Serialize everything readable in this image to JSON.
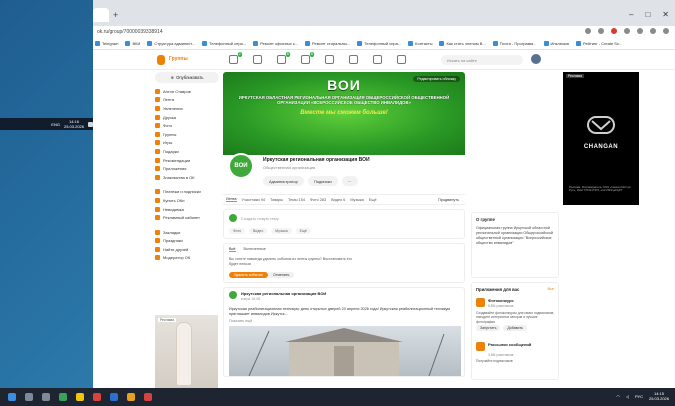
{
  "desktop": {
    "old_taskbar": {
      "lang": "ENG",
      "time": "14:16",
      "date": "25.03.2026"
    }
  },
  "browser": {
    "new_tab": "+",
    "url": "ok.ru/group/70000039338914",
    "bookmarks": [
      {
        "label": "Telegram",
        "icon": "telegram-icon"
      },
      {
        "label": "ВКИ",
        "icon": "vk-icon"
      },
      {
        "label": "Структура админист...",
        "icon": "page-icon"
      },
      {
        "label": "Телефонный спра...",
        "icon": "page-icon"
      },
      {
        "label": "Ремонт офисных к...",
        "icon": "page-icon"
      },
      {
        "label": "Ремонт стиральны...",
        "icon": "page-icon"
      },
      {
        "label": "Телефонный спра...",
        "icon": "page-icon"
      },
      {
        "label": "Контакты",
        "icon": "page-icon"
      },
      {
        "label": "Как стать членом В...",
        "icon": "page-icon"
      },
      {
        "label": "Почта - Программ...",
        "icon": "mail-icon"
      },
      {
        "label": "Инклюзия",
        "icon": "page-icon"
      },
      {
        "label": "Рейтинг - Create Sc...",
        "icon": "page-icon"
      }
    ]
  },
  "ok": {
    "logo_text": "Группы",
    "badges": [
      "2",
      "8",
      "8"
    ],
    "search_placeholder": "Искать на сайте",
    "sidebar": {
      "publish": "Опубликовать",
      "items": [
        "Антон Ставров",
        "Лента",
        "Увлечения",
        "Друзья",
        "Фото",
        "Группы",
        "Игры",
        "Подарки",
        "Рекомендации",
        "Приложения",
        "Знакомства в ОК"
      ],
      "items2": [
        "Платежи и подписки",
        "Купить ОКи",
        "Невидимка",
        "Рекламный кабинет"
      ],
      "items3": [
        "Закладки",
        "Праздники",
        "Найти друзей",
        "Модератор ОК"
      ],
      "ad_tag": "Реклама"
    },
    "cover": {
      "logo": "ВОИ",
      "org": "ИРКУТСКАЯ ОБЛАСТНАЯ РЕГИОНАЛЬНАЯ ОРГАНИЗАЦИЯ ОБЩЕРОССИЙСКОЙ ОБЩЕСТВЕННОЙ ОРГАНИЗАЦИИ «ВСЕРОССИЙСКОЕ ОБЩЕСТВО ИНВАЛИДОВ»",
      "slogan": "Вместе мы сможем больше!",
      "edit": "Редактировать обложку"
    },
    "group": {
      "logo_text": "ВОИ",
      "name": "Иркутская региональная организация ВОИ",
      "type": "Общественная организация",
      "admin_btn": "Администратор",
      "sub_btn": "Подписки",
      "more_btn": "···"
    },
    "tabs": [
      "Лента",
      "Участники 94",
      "Товары",
      "Темы 154",
      "Фото 283",
      "Видео 6",
      "Музыка",
      "Ещё"
    ],
    "promote": "Продвинуть",
    "newpost": {
      "placeholder": "Создать новую тему",
      "btns": [
        "Фото",
        "Видео",
        "Музыка",
        "Ещё"
      ]
    },
    "events": {
      "tabs": [
        "Всё",
        "Включенные"
      ],
      "question": "Вы хотите навсегда удалить события из ленты группы? Восстановить его будет нельзя",
      "delete": "Удалить событие",
      "cancel": "Отменить"
    },
    "post": {
      "name": "Иркутская региональная организация ВОИ",
      "date": "вчера 16:08",
      "text": "Иркутская реабилитационная техникум: день открытых дверей 23 апреля 2026 года! Иркутская реабилитационный техникум приглашает инвалидов Иркутск...",
      "more": "Показать ещё"
    },
    "about": {
      "title": "О группе",
      "text": "Официальная группа Иркутской областной региональной организации Общероссийской общественной организации \"Всероссийское общество инвалидов\""
    },
    "apps": {
      "title": "Приложения для вас",
      "all": "Все",
      "items": [
        {
          "name": "Фотоконкурс",
          "sub": "6,8M участников",
          "desc": "Создавайте фотоконкурсы для своих подписчиков, находите интересных авторов и лучшие фотографии",
          "b1": "Запустить",
          "b2": "Добавить"
        },
        {
          "name": "Рассылки сообщений",
          "sub": "3,8M участников",
          "desc": "Получайте подписчиков",
          "b1": "Запустить",
          "b2": "Добавить"
        }
      ]
    },
    "ad": {
      "label": "Реклама",
      "brand": "CHANGAN",
      "fine": "Реклама. Рекламодатель ООО «Чанган Моторс Рус», ИНН 7704217370, erid 2SDnjeb1jPT"
    }
  },
  "taskbar": {
    "lang": "РУС",
    "time": "14:15",
    "date": "25.03.2026"
  }
}
